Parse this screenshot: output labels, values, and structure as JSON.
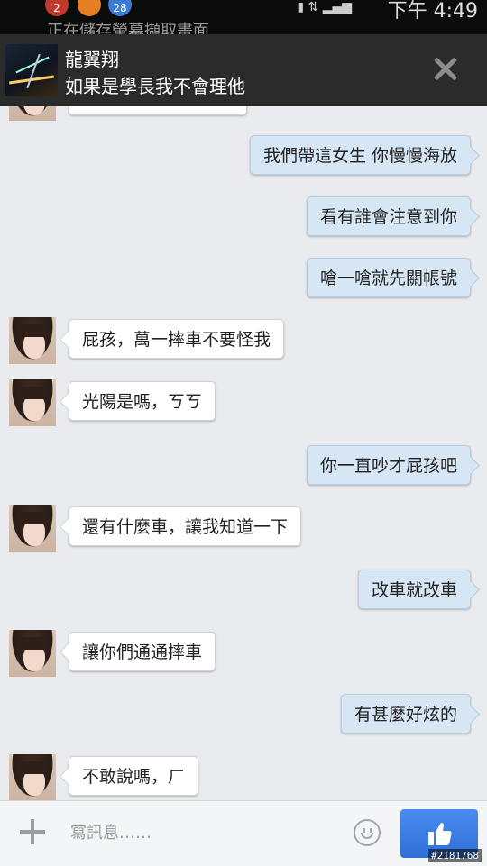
{
  "status_bar": {
    "notification_text": "正在儲存螢幕擷取畫面",
    "badge_1": "2",
    "badge_2": "28",
    "time": "下午 4:49"
  },
  "chat_head": {
    "name": "龍翼翔",
    "last_message": "如果是學長我不會理他",
    "close_icon": "close-icon"
  },
  "messages": [
    {
      "side": "out",
      "text": "我們帶這女生 你慢慢海放"
    },
    {
      "side": "out",
      "text": "看有誰會注意到你"
    },
    {
      "side": "out",
      "text": "嗆一嗆就先關帳號"
    },
    {
      "side": "in",
      "text": "屁孩，萬一摔車不要怪我"
    },
    {
      "side": "in",
      "text": "光陽是嗎，ㄎㄎ"
    },
    {
      "side": "out",
      "text": "你一直吵才屁孩吧"
    },
    {
      "side": "in",
      "text": "還有什麼車，讓我知道一下"
    },
    {
      "side": "out",
      "text": "改車就改車"
    },
    {
      "side": "in",
      "text": "讓你們通通摔車"
    },
    {
      "side": "out",
      "text": "有甚麼好炫的"
    },
    {
      "side": "in",
      "text": "不敢說嗎，ㄏ"
    }
  ],
  "composer": {
    "placeholder": "寫訊息……",
    "add_icon": "plus-icon",
    "emoji_icon": "smiley-icon",
    "like_icon": "thumbs-up-icon"
  },
  "watermark": "#2181768",
  "colors": {
    "outgoing_bubble": "#d6e6f5",
    "incoming_bubble": "#ffffff",
    "like_button": "#3b7ce3",
    "header_bg": "#2b2b2b"
  }
}
